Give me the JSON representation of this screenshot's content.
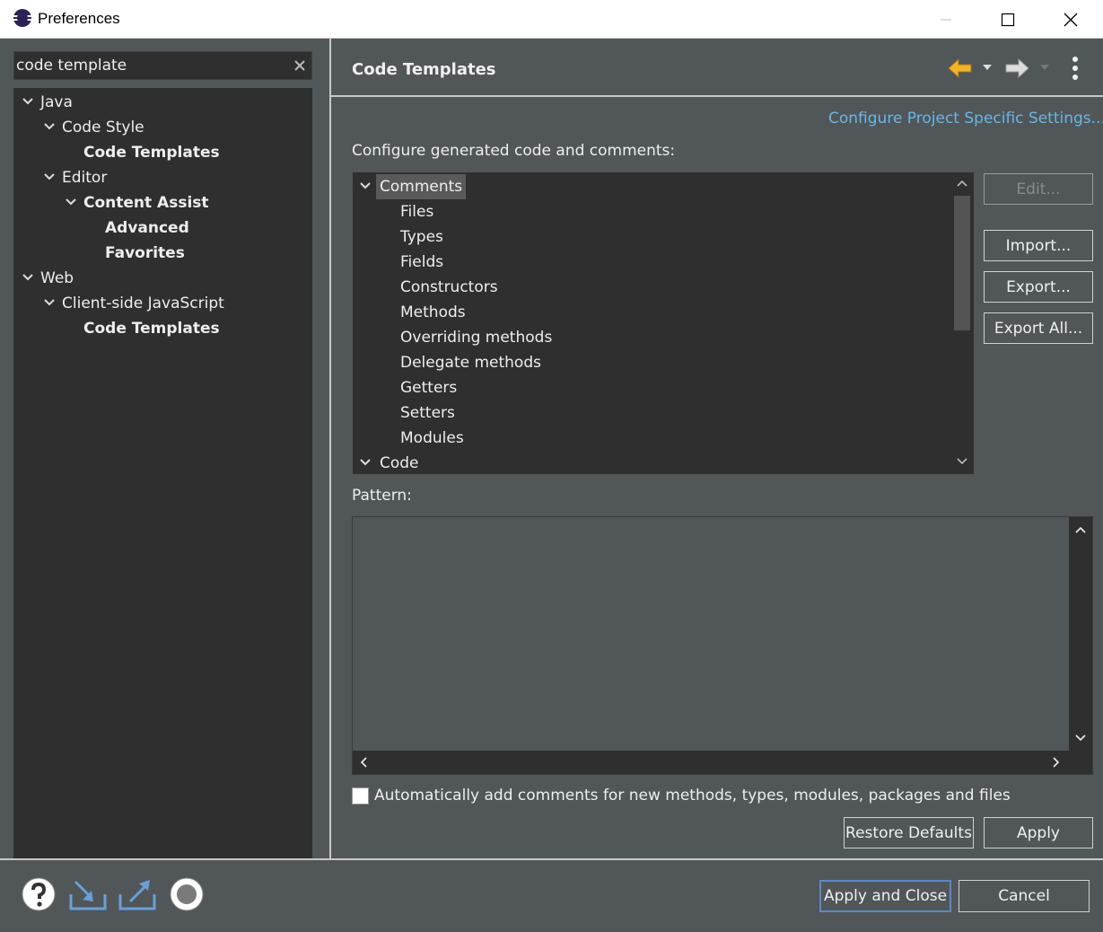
{
  "window": {
    "title": "Preferences"
  },
  "filter": {
    "value": "code template"
  },
  "nav_tree": [
    {
      "label": "Java",
      "bold": false,
      "expanded": true
    },
    {
      "label": "Code Style",
      "bold": false,
      "expanded": true
    },
    {
      "label": "Code Templates",
      "bold": true
    },
    {
      "label": "Editor",
      "bold": false,
      "expanded": true
    },
    {
      "label": "Content Assist",
      "bold": true,
      "expanded": true
    },
    {
      "label": "Advanced",
      "bold": true
    },
    {
      "label": "Favorites",
      "bold": true
    },
    {
      "label": "Web",
      "bold": false,
      "expanded": true
    },
    {
      "label": "Client-side JavaScript",
      "bold": false,
      "expanded": true
    },
    {
      "label": "Code Templates",
      "bold": true
    }
  ],
  "page": {
    "title": "Code Templates",
    "project_link": "Configure Project Specific Settings...",
    "configure_label": "Configure generated code and comments:",
    "pattern_label": "Pattern:",
    "auto_comment_label": "Automatically add comments for new methods, types, modules, packages and files",
    "auto_comment_checked": false
  },
  "template_tree": {
    "group_comments": "Comments",
    "comments": [
      "Files",
      "Types",
      "Fields",
      "Constructors",
      "Methods",
      "Overriding methods",
      "Delegate methods",
      "Getters",
      "Setters",
      "Modules"
    ],
    "group_code": "Code"
  },
  "buttons": {
    "edit": "Edit...",
    "import": "Import...",
    "export": "Export...",
    "export_all": "Export All...",
    "restore_defaults": "Restore Defaults",
    "apply": "Apply",
    "apply_close": "Apply and Close",
    "cancel": "Cancel"
  },
  "colors": {
    "background": "#515658",
    "tree_background": "#2f2f2f",
    "link": "#69b7e6",
    "back_arrow": "#f0b429"
  }
}
